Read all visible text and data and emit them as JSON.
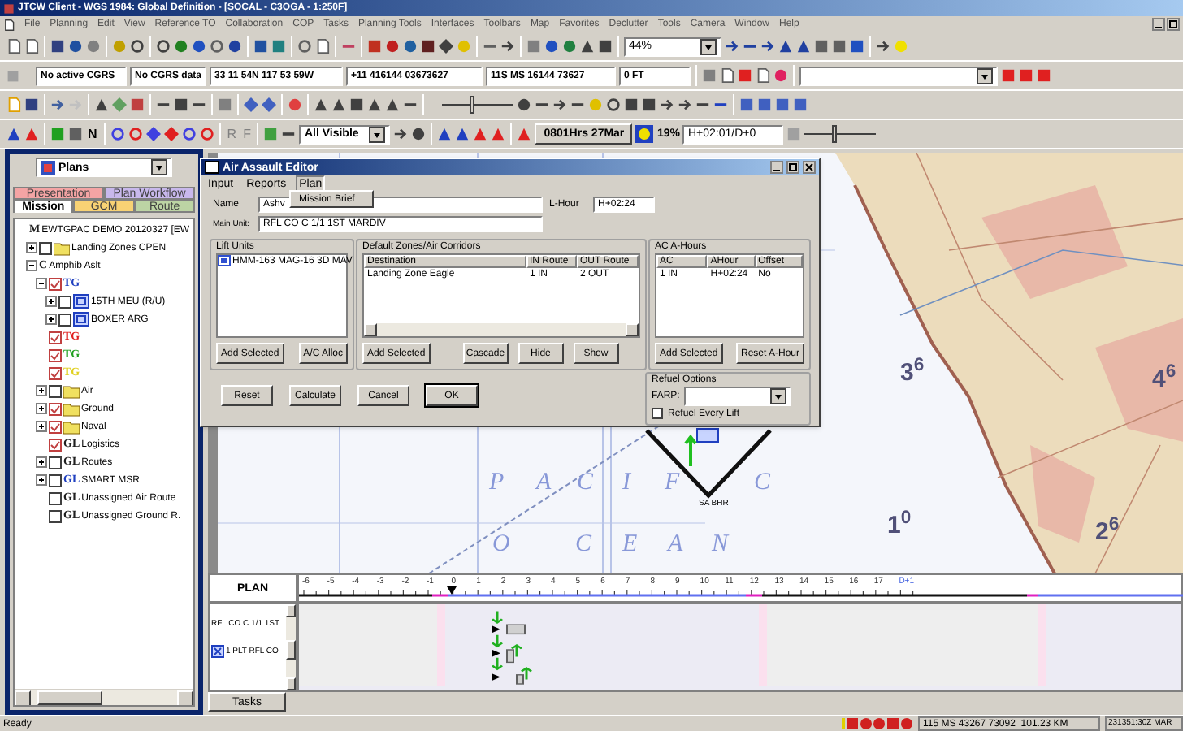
{
  "window": {
    "title": "JTCW Client - WGS 1984: Global Definition - [SOCAL - C3OGA - 1:250F]"
  },
  "menu": [
    "File",
    "Planning",
    "Edit",
    "View",
    "Reference TO",
    "Collaboration",
    "COP",
    "Tasks",
    "Planning Tools",
    "Interfaces",
    "Toolbars",
    "Map",
    "Favorites",
    "Declutter",
    "Tools",
    "Camera",
    "Window",
    "Help"
  ],
  "toolbar": {
    "zoom_value": "44%",
    "coordinate_fields": [
      "No active CGRS",
      "No CGRS data",
      "33 11 54N 117 53 59W",
      "+11 416144 03673627",
      "11S MS 16144 73627",
      "0 FT"
    ],
    "letter_buttons": [
      "N",
      "R",
      "F"
    ],
    "visibility_filter": "All Visible",
    "time_display": "0801Hrs 27Mar",
    "progress_reading": "19%",
    "h_hour_field": "H+02:01/D+0",
    "sliders": [
      {
        "level": 0.4
      },
      {
        "level": 0.4
      }
    ]
  },
  "left_panel": {
    "plans_dropdown": "Plans",
    "tab_rows": [
      [
        {
          "label": "Presentation",
          "color": "#f4a4a4",
          "selected": false
        },
        {
          "label": "Plan Workflow",
          "color": "#c8b8ec",
          "selected": false
        }
      ],
      [
        {
          "label": "Mission",
          "color": "#ffffff",
          "selected": true
        },
        {
          "label": "GCM",
          "color": "#f8d274",
          "selected": false
        },
        {
          "label": "Route",
          "color": "#bcd4a4",
          "selected": false
        }
      ]
    ],
    "tree": [
      {
        "kind": "symbol",
        "symbol": "M",
        "color": "#202020",
        "label": "EWTGPAC DEMO 20120327 [EW",
        "children": [
          {
            "kind": "folder",
            "expanded": false,
            "checked": false,
            "label": "Landing Zones CPEN"
          },
          {
            "kind": "symbol",
            "symbol": "C",
            "color": "#202020",
            "expanded": true,
            "label": "Amphib Aslt",
            "children": [
              {
                "kind": "symbol",
                "symbol": "TG",
                "color": "#2040c0",
                "expanded": true,
                "checked": true,
                "children": [
                  {
                    "kind": "unit",
                    "expanded": false,
                    "checked": false,
                    "label": "15TH MEU (R/U)"
                  },
                  {
                    "kind": "unit",
                    "expanded": false,
                    "checked": false,
                    "label": "BOXER ARG"
                  }
                ]
              },
              {
                "kind": "symbol",
                "symbol": "TG",
                "color": "#e02020",
                "checked": true
              },
              {
                "kind": "symbol",
                "symbol": "TG",
                "color": "#20a020",
                "checked": true
              },
              {
                "kind": "symbol",
                "symbol": "TG",
                "color": "#e0d020",
                "checked": true
              },
              {
                "kind": "folder",
                "expanded": false,
                "checked": false,
                "label": "Air"
              },
              {
                "kind": "folder",
                "expanded": false,
                "checked": true,
                "label": "Ground"
              },
              {
                "kind": "folder",
                "expanded": false,
                "checked": true,
                "label": "Naval"
              },
              {
                "kind": "symbol",
                "symbol": "GL",
                "color": "#202020",
                "checked": true,
                "label": "Logistics"
              },
              {
                "kind": "symbol",
                "symbol": "GL",
                "color": "#202020",
                "expanded": false,
                "checked": false,
                "label": "Routes"
              },
              {
                "kind": "symbol",
                "symbol": "GL",
                "color": "#2040c0",
                "expanded": false,
                "checked": false,
                "label": "SMART MSR"
              },
              {
                "kind": "symbol",
                "symbol": "GL",
                "color": "#202020",
                "checked": false,
                "label": "Unassigned Air Route"
              },
              {
                "kind": "symbol",
                "symbol": "GL",
                "color": "#202020",
                "checked": false,
                "label": "Unassigned Ground R."
              }
            ]
          }
        ]
      }
    ]
  },
  "map": {
    "ocean_labels": [
      "P",
      "A",
      "C",
      "I",
      "F",
      "C",
      "O",
      "C",
      "E",
      "A",
      "N"
    ],
    "grid_labels": [
      "1$^{0}$",
      "2$^{6}$",
      "3$^{6}$",
      "4$^{6}$"
    ],
    "point_label": "SA BHR"
  },
  "dialog": {
    "title": "Air Assault Editor",
    "menu": [
      {
        "label": "Input",
        "selected": false
      },
      {
        "label": "Reports",
        "selected": false
      },
      {
        "label": "Plan",
        "selected": true
      }
    ],
    "popup_menu": [
      "Mission Brief"
    ],
    "name_label": "Name",
    "name_value": "Ashv",
    "lhour_label": "L-Hour",
    "lhour_value": "H+02:24",
    "main_unit_label": "Main Unit:",
    "main_unit_value": "RFL CO C 1/1 1ST MARDIV",
    "lift_units": {
      "title": "Lift Units",
      "items": [
        "HMM-163 MAG-16 3D MAV"
      ],
      "buttons": [
        "Add Selected",
        "A/C Alloc"
      ]
    },
    "zones": {
      "title": "Default Zones/Air Corridors",
      "columns": [
        "Destination",
        "IN Route",
        "OUT Route"
      ],
      "rows": [
        [
          "Landing Zone Eagle",
          "1 IN",
          "2 OUT"
        ]
      ],
      "buttons": [
        "Add Selected",
        "Cascade",
        "Hide",
        "Show"
      ]
    },
    "ahours": {
      "title": "AC A-Hours",
      "columns": [
        "AC",
        "AHour",
        "Offset"
      ],
      "rows": [
        [
          "1 IN",
          "H+02:24",
          "No"
        ]
      ],
      "buttons": [
        "Add Selected",
        "Reset A-Hour"
      ]
    },
    "refuel": {
      "title": "Refuel Options",
      "farp_label": "FARP:",
      "option": {
        "label": "Refuel Every Lift",
        "checked": false
      }
    },
    "buttons": [
      {
        "label": "Reset",
        "default": false
      },
      {
        "label": "Calculate",
        "default": false
      },
      {
        "label": "Cancel",
        "default": false
      },
      {
        "label": "OK",
        "default": true
      }
    ]
  },
  "timeline": {
    "title": "PLAN",
    "ticks": [
      "-6",
      "-5",
      "-4",
      "-3",
      "-2",
      "-1",
      "0",
      "1",
      "2",
      "3",
      "4",
      "5",
      "6",
      "7",
      "8",
      "9",
      "10",
      "11",
      "12",
      "13",
      "14",
      "15",
      "16",
      "17",
      "D+1"
    ],
    "rows": [
      {
        "kind": "unit",
        "label": "RFL CO C 1/1 1ST"
      },
      {
        "kind": "platoon",
        "label": "1 PLT RFL CO"
      }
    ],
    "tab": "Tasks"
  },
  "status_bar": {
    "message": "Ready",
    "position": "115 MS 43267 73092  101.23 KM",
    "time": "231351:30Z MAR"
  }
}
